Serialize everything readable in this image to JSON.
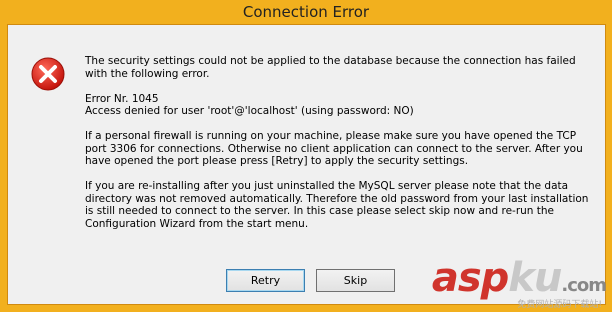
{
  "window": {
    "title": "Connection Error"
  },
  "icon": "error-icon",
  "message": {
    "paragraphs": [
      "The security settings could not be applied to the database because the connection has failed with the following error.",
      "Error Nr. 1045\nAccess denied for user 'root'@'localhost' (using password: NO)",
      "If a personal firewall is running on your machine, please make sure you have opened the TCP port 3306 for connections. Otherwise no client application can connect to the server. After you have opened the port please press [Retry] to apply the security settings.",
      "If you are re-installing after you just uninstalled the MySQL server please note that the data directory was not removed automatically. Therefore the old password from your last installation is still needed to connect to the server. In this case please select skip now and re-run the Configuration Wizard from the start menu."
    ]
  },
  "buttons": {
    "retry": "Retry",
    "skip": "Skip"
  },
  "watermark": {
    "asp": "asp",
    "ku": "ku",
    "com": ".com",
    "sub": "免费网站源码下载站!"
  },
  "colors": {
    "titlebar": "#f2b01e",
    "client": "#f0f0f0",
    "error_red": "#d9261c",
    "watermark_red": "#d0342c"
  }
}
